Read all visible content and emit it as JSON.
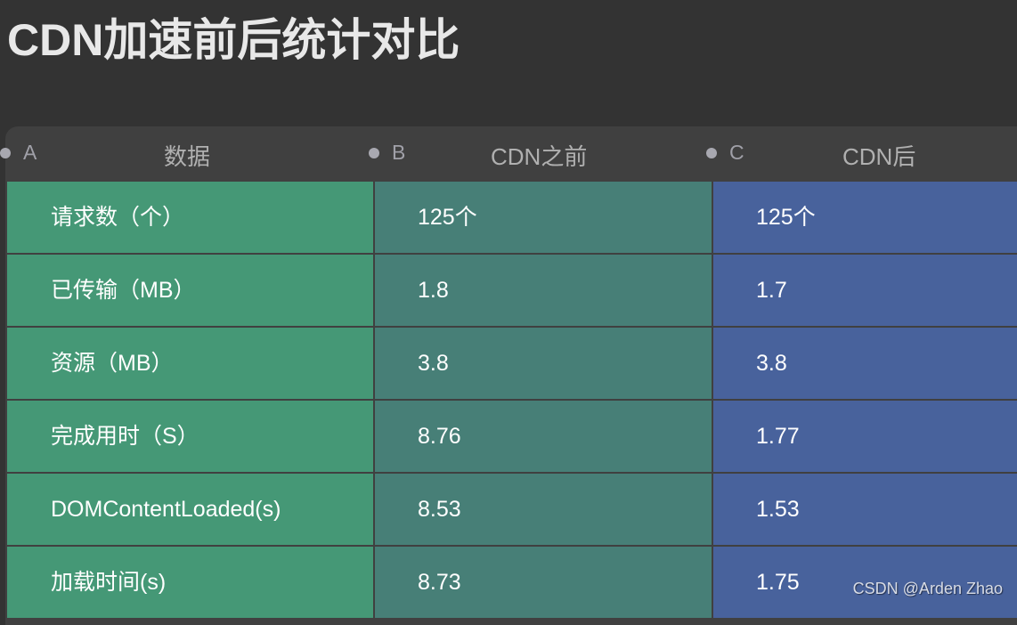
{
  "title": "CDN加速前后统计对比",
  "columns": [
    {
      "letter": "A",
      "name": "数据"
    },
    {
      "letter": "B",
      "name": "CDN之前"
    },
    {
      "letter": "C",
      "name": "CDN后"
    }
  ],
  "rows": [
    {
      "metric": "请求数（个）",
      "before": "125个",
      "after": "125个"
    },
    {
      "metric": "已传输（MB）",
      "before": "1.8",
      "after": "1.7"
    },
    {
      "metric": "资源（MB）",
      "before": "3.8",
      "after": "3.8"
    },
    {
      "metric": "完成用时（S）",
      "before": "8.76",
      "after": "1.77"
    },
    {
      "metric": "DOMContentLoaded(s)",
      "before": "8.53",
      "after": "1.53"
    },
    {
      "metric": "加载时间(s)",
      "before": "8.73",
      "after": "1.75"
    }
  ],
  "colors": {
    "column_a": "#459876",
    "column_b": "#477f77",
    "column_c": "#48629c",
    "background": "#333333"
  },
  "watermark": "CSDN @Arden Zhao"
}
